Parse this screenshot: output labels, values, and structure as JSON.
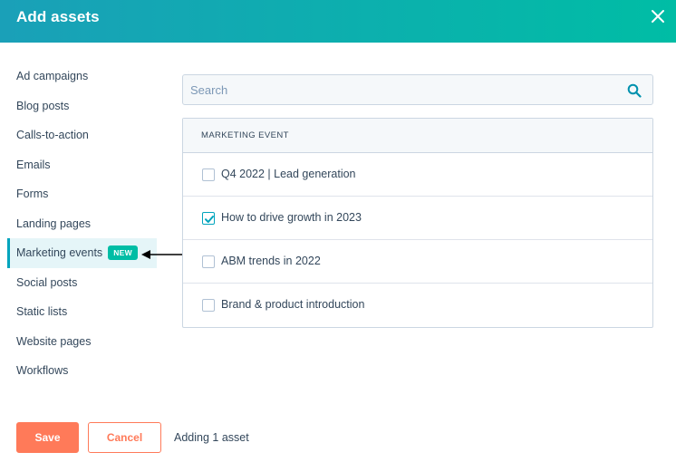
{
  "header": {
    "title": "Add assets"
  },
  "sidebar": {
    "items": [
      {
        "label": "Ad campaigns"
      },
      {
        "label": "Blog posts"
      },
      {
        "label": "Calls-to-action"
      },
      {
        "label": "Emails"
      },
      {
        "label": "Forms"
      },
      {
        "label": "Landing pages"
      },
      {
        "label": "Marketing events",
        "badge": "NEW",
        "active": true
      },
      {
        "label": "Social posts"
      },
      {
        "label": "Static lists"
      },
      {
        "label": "Website pages"
      },
      {
        "label": "Workflows"
      }
    ]
  },
  "search": {
    "placeholder": "Search",
    "value": ""
  },
  "table": {
    "header": "MARKETING EVENT",
    "rows": [
      {
        "label": "Q4 2022 | Lead generation",
        "checked": false
      },
      {
        "label": "How to drive growth in 2023",
        "checked": true
      },
      {
        "label": "ABM trends in 2022",
        "checked": false
      },
      {
        "label": "Brand & product introduction",
        "checked": false
      }
    ]
  },
  "footer": {
    "save_label": "Save",
    "cancel_label": "Cancel",
    "status": "Adding 1 asset"
  },
  "colors": {
    "header_gradient_start": "#1aa0b8",
    "header_gradient_end": "#00bda5",
    "accent": "#00a4bd",
    "primary_button": "#ff7a59",
    "badge": "#00bda5"
  }
}
